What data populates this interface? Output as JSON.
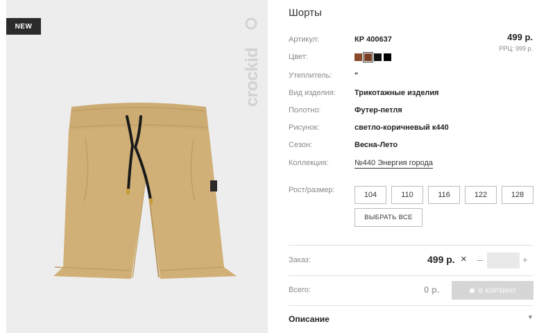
{
  "product": {
    "badge": "NEW",
    "brand": "crockid",
    "title": "Шорты",
    "price": "499 р.",
    "rrp": "РРЦ: 999 р."
  },
  "attributes": {
    "article_label": "Артикул:",
    "article_value": "КР 400637",
    "color_label": "Цвет:",
    "insulation_label": "Утеплитель:",
    "insulation_value": "\"",
    "type_label": "Вид изделия:",
    "type_value": "Трикотажные изделия",
    "fabric_label": "Полотно:",
    "fabric_value": "Футер-петля",
    "pattern_label": "Рисунок:",
    "pattern_value": "светло-коричневый к440",
    "season_label": "Сезон:",
    "season_value": "Весна-Лето",
    "collection_label": "Коллекция:",
    "collection_value": "№440 Энергия города"
  },
  "colors": [
    "#8b4a2b",
    "#7a3e25",
    "#111111",
    "#000000"
  ],
  "size_label": "Рост/размер:",
  "sizes": [
    "104",
    "110",
    "116",
    "122",
    "128"
  ],
  "select_all": "ВЫБРАТЬ ВСЕ",
  "order": {
    "label": "Заказ:",
    "price": "499 р.",
    "times": "×",
    "minus": "–",
    "plus": "+",
    "quantity": ""
  },
  "total": {
    "label": "Всего:",
    "value": "0 р.",
    "cart_button": "В КОРЗИНУ"
  },
  "description": {
    "title": "Описание",
    "chevron": "▼"
  },
  "icons": {
    "cart": "basket-icon",
    "logo": "crockid-logo"
  }
}
